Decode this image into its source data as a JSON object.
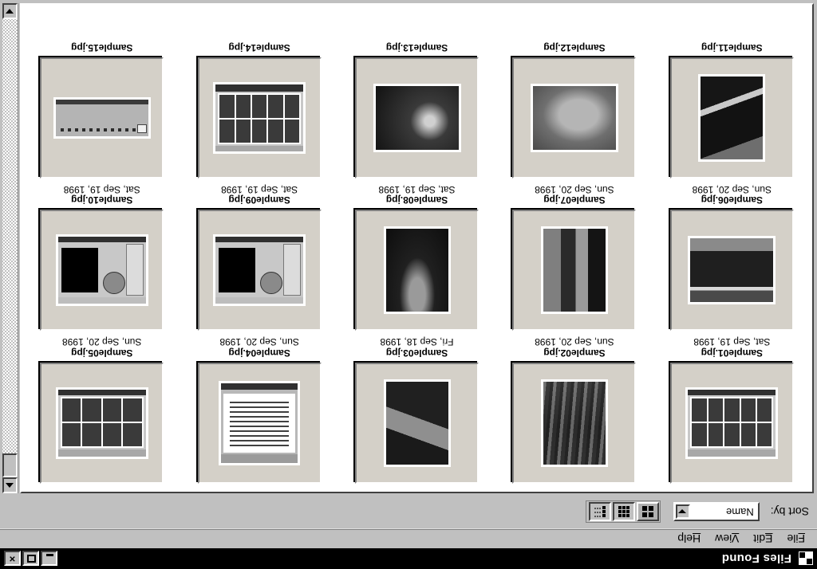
{
  "window": {
    "title": "Files Found",
    "icon": "app-window-icon",
    "controls": {
      "minimize": "minimize-button",
      "maximize": "maximize-button",
      "close": "close-button",
      "close_glyph": "×"
    }
  },
  "menubar": {
    "items": [
      {
        "label": "File",
        "mnemonic": "F",
        "rest": "ile"
      },
      {
        "label": "Edit",
        "mnemonic": "E",
        "rest": "dit"
      },
      {
        "label": "View",
        "mnemonic": "V",
        "rest": "iew"
      },
      {
        "label": "Help",
        "mnemonic": "H",
        "rest": "elp"
      }
    ]
  },
  "toolbar": {
    "sort_label": "Sort by:",
    "sort_value": "Name",
    "sort_options": [
      "Name"
    ],
    "view_buttons": [
      {
        "name": "large-thumbnails-view",
        "active": true
      },
      {
        "name": "medium-thumbnails-view",
        "active": false
      },
      {
        "name": "list-view",
        "active": false
      }
    ]
  },
  "scrollbar": {
    "up_arrow": "scroll-up-arrow",
    "down_arrow": "scroll-down-arrow",
    "thumb_position_percent": 0
  },
  "files": [
    {
      "name": "Sample01.jpg",
      "date": "Sat, Sep 19, 1998",
      "kind": "screenshot-wide"
    },
    {
      "name": "Sample02.jpg",
      "date": "Sun, Sep 20, 1998",
      "kind": "screenshot-grid"
    },
    {
      "name": "Sample03.jpg",
      "date": "Fri, Sep 18, 1998",
      "kind": "screenshot-small"
    },
    {
      "name": "Sample04.jpg",
      "date": "Sun, Sep 20, 1998",
      "kind": "screenshot-doc"
    },
    {
      "name": "Sample05.jpg",
      "date": "Sun, Sep 20, 1998",
      "kind": "screenshot-grid2"
    },
    {
      "name": "Sample06.jpg",
      "date": "Sun, Sep 20, 1998",
      "kind": "photo-portrait-dark"
    },
    {
      "name": "Sample07.jpg",
      "date": "Sun, Sep 20, 1998",
      "kind": "photo-portrait-city"
    },
    {
      "name": "Sample08.jpg",
      "date": "Sat, Sep 19, 1998",
      "kind": "photo-portrait-cave"
    },
    {
      "name": "Sample09.jpg",
      "date": "Sat, Sep 19, 1998",
      "kind": "screenshot-dialog"
    },
    {
      "name": "Sample10.jpg",
      "date": "Sat, Sep 19, 1998",
      "kind": "screenshot-dialog"
    },
    {
      "name": "Sample11.jpg",
      "date": "",
      "kind": "photo-portrait-tunnel"
    },
    {
      "name": "Sample12.jpg",
      "date": "",
      "kind": "photo-landscape-leaf"
    },
    {
      "name": "Sample13.jpg",
      "date": "",
      "kind": "photo-landscape-fish"
    },
    {
      "name": "Sample14.jpg",
      "date": "",
      "kind": "screenshot-thumbs"
    },
    {
      "name": "Sample15.jpg",
      "date": "",
      "kind": "screenshot-toolbar"
    }
  ]
}
